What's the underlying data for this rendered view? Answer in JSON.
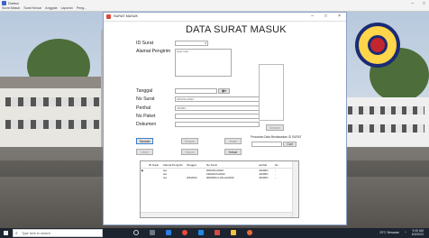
{
  "app": {
    "title": "Dolma",
    "menu": [
      "Surat Masuk",
      "Surat Keluar",
      "Anggota",
      "Laporan",
      "Peng..."
    ]
  },
  "window": {
    "title": "SURAT MASUK",
    "heading": "DATA SURAT MASUK",
    "controls": [
      "–",
      "□",
      "×"
    ]
  },
  "form": {
    "id_surat_label": "ID Surat",
    "alamat_label": "Alamat Pengirim",
    "alamat_value": "Ayam aku",
    "tanggal_label": "Tanggal",
    "no_surat_label": "No Surat",
    "no_surat_value": "000/22/x/2022",
    "perihal_label": "Perihal",
    "perihal_value": "JANMO",
    "no_paket_label": "No Paket",
    "dokumen_label": "Dokumen",
    "dokumen_value": "-",
    "tanggal_btn": "▦▾",
    "upload_btn": "Browse"
  },
  "buttons": {
    "tambah": "Tambah",
    "simpan": "Simpan",
    "batal": "Batal",
    "ubah": "Ubah",
    "hapus": "Hapus",
    "keluar": "Keluar"
  },
  "search": {
    "label": "Pencarian Data Berdasarkan ID SURAT",
    "button": "Cari"
  },
  "table": {
    "columns": [
      "ID Surat",
      "Alamat Pengirim",
      "Tanggal",
      "No Surat",
      "perihal",
      "No"
    ],
    "rows": [
      {
        "marker": "▶",
        "id": "",
        "alamat": "tes",
        "tanggal": "",
        "no_surat": "000/22/x/2022",
        "perihal": "JANMO",
        "no": "-"
      },
      {
        "marker": "",
        "id": "",
        "alamat": "tes",
        "tanggal": "",
        "no_surat": "1900/22/x/2022",
        "perihal": "JANMO",
        "no": "-"
      },
      {
        "marker": "",
        "id": "",
        "alamat": "tes",
        "tanggal": "3/3/2022",
        "no_surat": "000/93/1/x-22mei/2022",
        "perihal": "JANMO",
        "no": "-"
      }
    ]
  },
  "taskbar": {
    "search_placeholder": "Type here to search",
    "weather": "29°C Berawan",
    "time": "9:40 AM",
    "date": "5/3/2022"
  },
  "colors": {
    "taskbar_bg": "#1c2430",
    "dialog_border": "#8aa0c8",
    "active_button_border": "#3c7fd0"
  }
}
